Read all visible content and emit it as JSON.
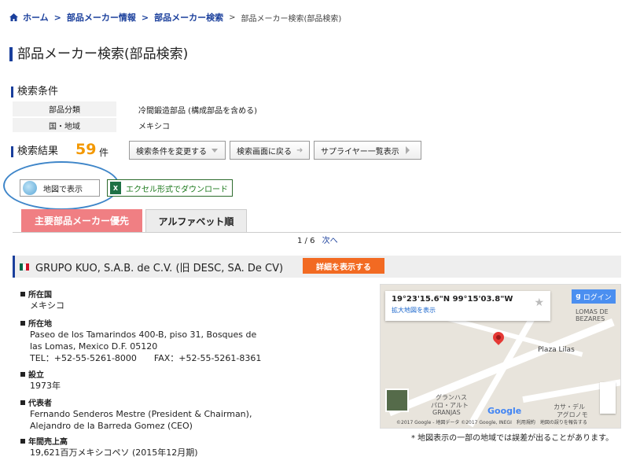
{
  "breadcrumb": {
    "home": "ホーム",
    "items": [
      "部品メーカー情報",
      "部品メーカー検索"
    ],
    "current": "部品メーカー検索(部品検索)"
  },
  "page_title": "部品メーカー検索(部品検索)",
  "conditions": {
    "heading": "検索条件",
    "rows": [
      {
        "label": "部品分類",
        "value": "冷間鍛造部品 (構成部品を含める)"
      },
      {
        "label": "国・地域",
        "value": "メキシコ"
      }
    ]
  },
  "results": {
    "heading": "検索結果",
    "count": "59",
    "unit": "件",
    "buttons": {
      "change": "検索条件を変更する",
      "back": "検索画面に戻る",
      "supplier_list": "サプライヤー一覧表示",
      "map": "地図で表示",
      "excel": "エクセル形式でダウンロード"
    },
    "tabs": [
      "主要部品メーカー優先",
      "アルファベット順"
    ],
    "pager": {
      "text": "1 / 6",
      "next": "次へ"
    }
  },
  "company": {
    "name": "GRUPO KUO, S.A.B. de C.V. (旧 DESC, SA. De CV)",
    "detail_button": "詳細を表示する",
    "fields": [
      {
        "label": "所在国",
        "lines": [
          "メキシコ"
        ]
      },
      {
        "label": "所在地",
        "lines": [
          "Paseo de los Tamarindos 400-B, piso 31, Bosques de",
          "las Lomas, Mexico D.F. 05120",
          "TEL：+52-55-5261-8000　　FAX：+52-55-5261-8361"
        ]
      },
      {
        "label": "設立",
        "lines": [
          "1973年"
        ]
      },
      {
        "label": "代表者",
        "lines": [
          "Fernando Senderos Mestre (President & Chairman),",
          "Alejandro de la Barreda Gomez (CEO)"
        ]
      },
      {
        "label": "年間売上高",
        "lines": [
          "19,621百万メキシコペソ (2015年12月期)"
        ]
      }
    ]
  },
  "map": {
    "coords": "19°23'15.6\"N 99°15'03.8\"W",
    "enlarge_link": "拡大地図を表示",
    "login": "ログイン",
    "labels": [
      "Plaza Lilas",
      "LOMAS DE BEZARES",
      "グランハス",
      "パロ・アルト",
      "GRANJAS",
      "カサ・デル",
      "アグロノモ"
    ],
    "google": "Google",
    "attribution": "©2017 Google - 地図データ ©2017 Google, INEGI　利用規約　地図の誤りを報告する",
    "note": "* 地図表示の一部の地域では誤差が出ることがあります。"
  },
  "colors": {
    "accent": "#1a3f9c",
    "count": "#f39800",
    "tab_active": "#f07f83",
    "detail": "#f26a22"
  }
}
